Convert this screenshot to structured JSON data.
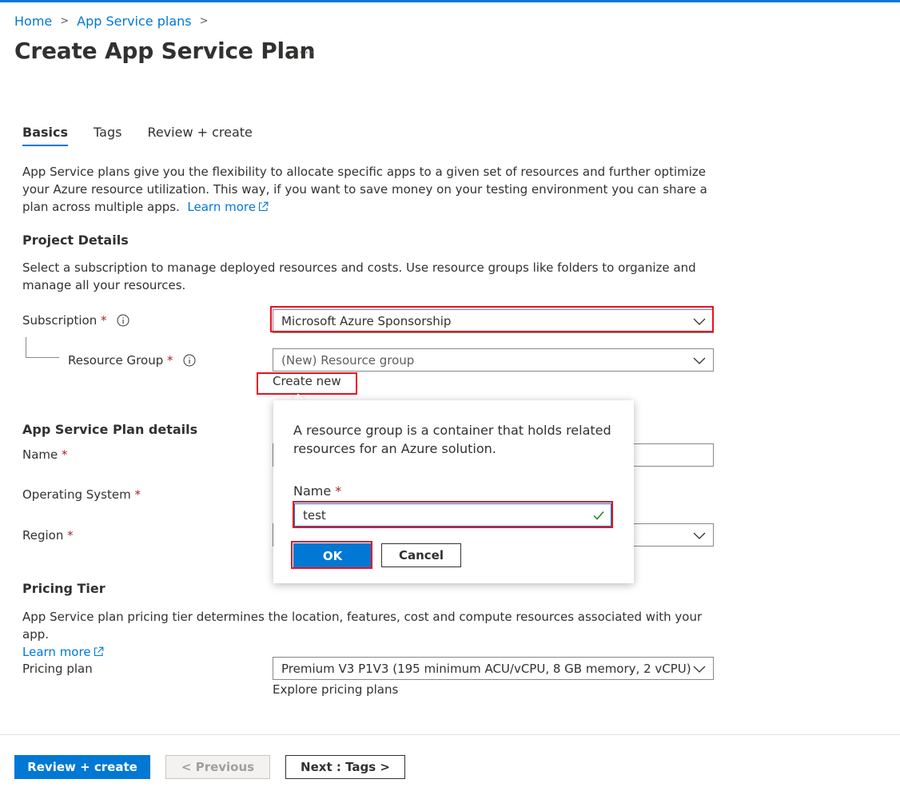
{
  "breadcrumb": {
    "home": "Home",
    "parent": "App Service plans"
  },
  "page": {
    "title": "Create App Service Plan",
    "more": "···"
  },
  "tabs": [
    {
      "label": "Basics",
      "active": true
    },
    {
      "label": "Tags",
      "active": false
    },
    {
      "label": "Review + create",
      "active": false
    }
  ],
  "intro": {
    "text": "App Service plans give you the flexibility to allocate specific apps to a given set of resources and further optimize your Azure resource utilization. This way, if you want to save money on your testing environment you can share a plan across multiple apps.",
    "link": "Learn more"
  },
  "project_details": {
    "heading": "Project Details",
    "description": "Select a subscription to manage deployed resources and costs. Use resource groups like folders to organize and manage all your resources.",
    "subscription_label": "Subscription",
    "subscription_value": "Microsoft Azure Sponsorship",
    "resource_group_label": "Resource Group",
    "resource_group_value": "(New) Resource group",
    "create_new": "Create new"
  },
  "plan_details": {
    "heading": "App Service Plan details",
    "name_label": "Name",
    "os_label": "Operating System",
    "region_label": "Region"
  },
  "pricing": {
    "heading": "Pricing Tier",
    "description": "App Service plan pricing tier determines the location, features, cost and compute resources associated with your app.",
    "learn_more": "Learn more",
    "plan_label": "Pricing plan",
    "plan_value": "Premium V3 P1V3 (195 minimum ACU/vCPU, 8 GB memory, 2 vCPU)",
    "explore": "Explore pricing plans"
  },
  "required_marker": "*",
  "popup": {
    "text": "A resource group is a container that holds related resources for an Azure solution.",
    "name_label": "Name",
    "name_value": "test",
    "ok": "OK",
    "cancel": "Cancel"
  },
  "footer": {
    "review_create": "Review + create",
    "previous": "< Previous",
    "next": "Next : Tags >"
  },
  "colors": {
    "accent": "#0078d4",
    "highlight": "#e81123",
    "required": "#a4262c",
    "valid": "#107c10"
  }
}
